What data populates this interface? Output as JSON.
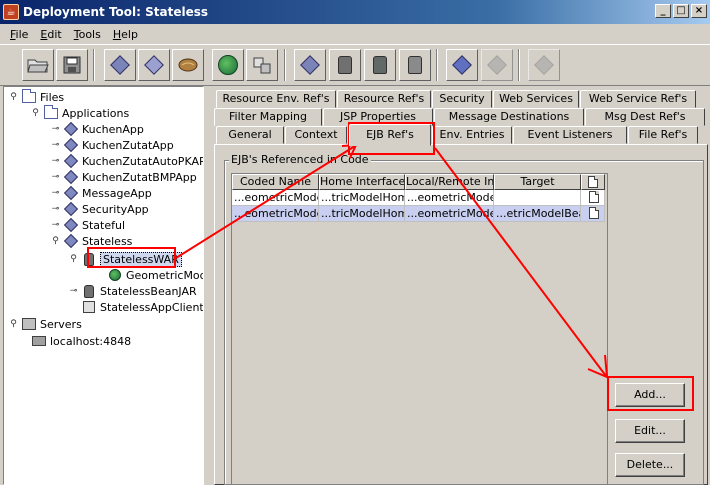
{
  "window": {
    "title": "Deployment Tool: Stateless",
    "controls": [
      "_",
      "□",
      "×"
    ],
    "app_icon": "java-cup-icon"
  },
  "menu": [
    {
      "label": "File",
      "mnemonic": "F",
      "rest": "ile"
    },
    {
      "label": "Edit",
      "mnemonic": "E",
      "rest": "dit"
    },
    {
      "label": "Tools",
      "mnemonic": "T",
      "rest": "ools"
    },
    {
      "label": "Help",
      "mnemonic": "H",
      "rest": "elp"
    }
  ],
  "toolbar": [
    {
      "name": "open-button",
      "icon": "folder-open-icon",
      "enabled": true
    },
    {
      "name": "save-button",
      "icon": "floppy-disk-icon",
      "enabled": true
    },
    {
      "name": "new-application-button",
      "icon": "application-diamond-icon",
      "enabled": true
    },
    {
      "name": "new-module-button",
      "icon": "module-diamond-icon",
      "enabled": true
    },
    {
      "name": "new-bean-button",
      "icon": "bean-icon",
      "enabled": true
    },
    {
      "name": "new-web-component-button",
      "icon": "globe-icon",
      "enabled": true
    },
    {
      "name": "new-client-button",
      "icon": "client-icon",
      "enabled": true
    },
    {
      "name": "add-to-application-button",
      "icon": "add-diamond-icon",
      "enabled": true
    },
    {
      "name": "add-ejb-jar-button",
      "icon": "jar-add-icon",
      "enabled": true
    },
    {
      "name": "add-war-button",
      "icon": "jar-web-icon",
      "enabled": true
    },
    {
      "name": "add-client-jar-button",
      "icon": "jar-client-icon",
      "enabled": true
    },
    {
      "name": "verify-button",
      "icon": "verify-icon",
      "enabled": true
    },
    {
      "name": "deploy-button",
      "icon": "deploy-icon",
      "enabled": false
    },
    {
      "name": "undeploy-button",
      "icon": "undeploy-icon",
      "enabled": false
    }
  ],
  "tree": {
    "root_label": "Files",
    "applications_label": "Applications",
    "apps": [
      "KuchenApp",
      "KuchenZutatApp",
      "KuchenZutatAutoPKAPP",
      "KuchenZutatBMPApp",
      "MessageApp",
      "SecurityApp",
      "Stateful",
      "Stateless"
    ],
    "stateless_children": {
      "war": "StatelessWAR",
      "war_child": "GeometricModel",
      "bean_jar": "StatelessBeanJAR",
      "client": "StatelessAppClient"
    },
    "servers_label": "Servers",
    "server": "localhost:4848"
  },
  "tabs": {
    "row1": [
      "Resource Env. Ref's",
      "Resource Ref's",
      "Security",
      "Web Services",
      "Web Service Ref's"
    ],
    "row2": [
      "Filter Mapping",
      "JSP Properties",
      "Message Destinations",
      "Msg Dest Ref's"
    ],
    "row3": [
      "General",
      "Context",
      "EJB Ref's",
      "Env. Entries",
      "Event Listeners",
      "File Ref's"
    ],
    "active": "EJB Ref's"
  },
  "ejb_refs": {
    "group_title": "EJB's Referenced in Code",
    "columns": [
      "Coded Name",
      "Home Interface",
      "Local/Remote In...",
      "Target",
      ""
    ],
    "rows": [
      [
        "...eometricModel",
        "...tricModelHome",
        "...eometricModel",
        "",
        ""
      ],
      [
        "...eometricModel",
        "...tricModelHome",
        "...eometricModel",
        "...etricModelBean",
        ""
      ]
    ],
    "buttons": {
      "add": "Add...",
      "edit": "Edit...",
      "delete": "Delete..."
    }
  },
  "annotation_color": "#ff0000"
}
